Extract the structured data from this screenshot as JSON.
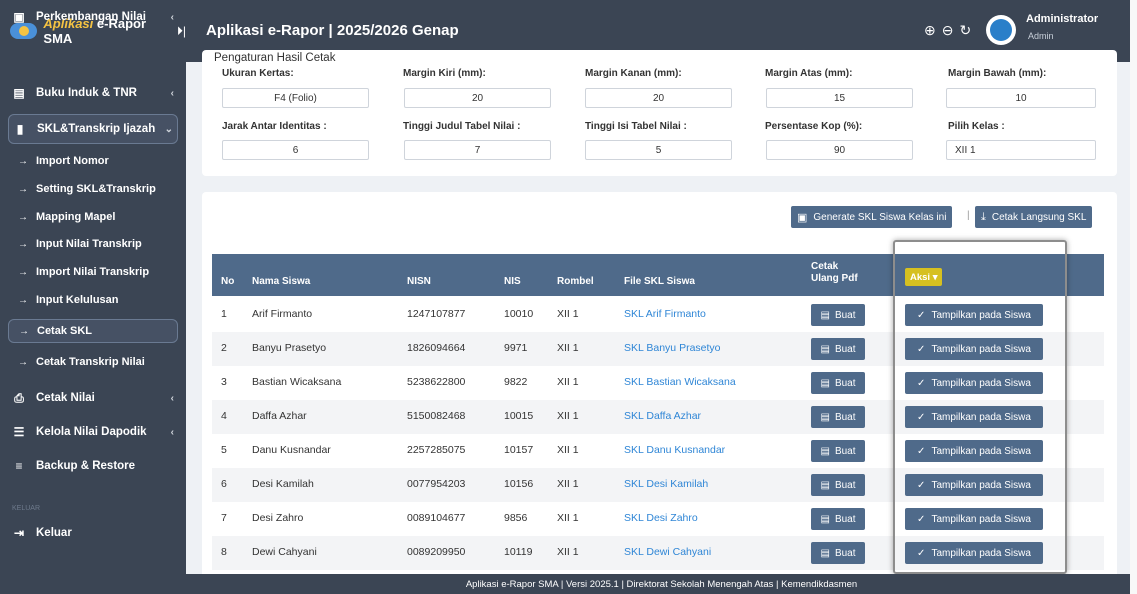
{
  "brand": {
    "part1": "Aplikasi",
    "part2": "e-Rapor SMA",
    "pin": "⏵|"
  },
  "app_title": "Aplikasi e-Rapor | 2025/2026 Genap",
  "user": {
    "name": "Administrator",
    "role": "Admin"
  },
  "sidebar": {
    "items": [
      {
        "label": "Perkembangan Nilai",
        "chev": "‹"
      },
      {
        "label": "Buku Induk & TNR",
        "chev": "‹"
      },
      {
        "label": "SKL&Transkrip Ijazah",
        "chev": "⌄"
      }
    ],
    "sub_items": [
      "Import Nomor",
      "Setting SKL&Transkrip",
      "Mapping Mapel",
      "Input Nilai Transkrip",
      "Import Nilai Transkrip",
      "Input Kelulusan",
      "Cetak SKL",
      "Cetak Transkrip Nilai"
    ],
    "items2": [
      {
        "label": "Cetak Nilai",
        "chev": "‹"
      },
      {
        "label": "Kelola Nilai Dapodik",
        "chev": "‹"
      },
      {
        "label": "Backup & Restore",
        "chev": ""
      }
    ],
    "section": "KELUAR",
    "logout": "Keluar"
  },
  "settings": {
    "title": "Pengaturan Hasil Cetak",
    "labels": [
      "Ukuran Kertas:",
      "Margin Kiri (mm):",
      "Margin Kanan (mm):",
      "Margin Atas (mm):",
      "Margin Bawah (mm):",
      "Jarak Antar Identitas :",
      "Tinggi Judul Tabel Nilai :",
      "Tinggi Isi Tabel Nilai :",
      "Persentase Kop (%):",
      "Pilih Kelas :"
    ],
    "values": [
      "F4 (Folio)",
      "20",
      "20",
      "15",
      "10",
      "6",
      "7",
      "5",
      "90",
      "XII 1"
    ]
  },
  "toolbar": {
    "generate": "Generate SKL Siswa Kelas ini",
    "sep": "|",
    "cetak": "Cetak Langsung SKL"
  },
  "table": {
    "headers": {
      "no": "No",
      "nama": "Nama Siswa",
      "nisn": "NISN",
      "nis": "NIS",
      "rombel": "Rombel",
      "file": "File SKL Siswa",
      "cetak1": "Cetak",
      "cetak2": "Ulang Pdf",
      "aksi": "Aksi ▾"
    },
    "buat_label": "Buat",
    "tampil_label": "Tampilkan pada Siswa",
    "rows": [
      {
        "no": "1",
        "nama": "Arif Firmanto",
        "nisn": "1247107877",
        "nis": "10010",
        "rombel": "XII 1",
        "file": "SKL Arif Firmanto"
      },
      {
        "no": "2",
        "nama": "Banyu Prasetyo",
        "nisn": "1826094664",
        "nis": "9971",
        "rombel": "XII 1",
        "file": "SKL Banyu Prasetyo"
      },
      {
        "no": "3",
        "nama": "Bastian Wicaksana",
        "nisn": "5238622800",
        "nis": "9822",
        "rombel": "XII 1",
        "file": "SKL Bastian Wicaksana"
      },
      {
        "no": "4",
        "nama": "Daffa Azhar",
        "nisn": "5150082468",
        "nis": "10015",
        "rombel": "XII 1",
        "file": "SKL Daffa Azhar"
      },
      {
        "no": "5",
        "nama": "Danu Kusnandar",
        "nisn": "2257285075",
        "nis": "10157",
        "rombel": "XII 1",
        "file": "SKL Danu Kusnandar"
      },
      {
        "no": "6",
        "nama": "Desi Kamilah",
        "nisn": "0077954203",
        "nis": "10156",
        "rombel": "XII 1",
        "file": "SKL Desi Kamilah"
      },
      {
        "no": "7",
        "nama": "Desi Zahro",
        "nisn": "0089104677",
        "nis": "9856",
        "rombel": "XII 1",
        "file": "SKL Desi Zahro"
      },
      {
        "no": "8",
        "nama": "Dewi Cahyani",
        "nisn": "0089209950",
        "nis": "10119",
        "rombel": "XII 1",
        "file": "SKL Dewi Cahyani"
      }
    ]
  },
  "footer": "Aplikasi e-Rapor SMA | Versi 2025.1 | Direktorat Sekolah Menengah Atas | Kemendikdasmen",
  "colors": {
    "sidebar": "#3b4554",
    "header": "#4f6a8a",
    "link": "#2f86d6",
    "aksi": "#d6c020"
  }
}
